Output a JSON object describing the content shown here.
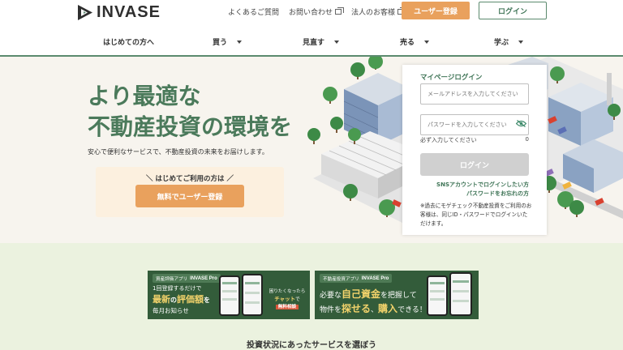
{
  "header": {
    "logo_text": "INVASE",
    "top_links": [
      {
        "label": "よくあるご質問",
        "external": false
      },
      {
        "label": "お問い合わせ",
        "external": true
      },
      {
        "label": "法人のお客様",
        "external": true
      }
    ],
    "register_label": "ユーザー登録",
    "login_label": "ログイン"
  },
  "nav": {
    "items": [
      {
        "label": "はじめての方へ",
        "dropdown": false
      },
      {
        "label": "買う",
        "dropdown": true
      },
      {
        "label": "見直す",
        "dropdown": true
      },
      {
        "label": "売る",
        "dropdown": true
      },
      {
        "label": "学ぶ",
        "dropdown": true
      }
    ]
  },
  "hero": {
    "title_line1": "より最適な",
    "title_line2": "不動産投資の環境を",
    "subtitle": "安心で便利なサービスで、不動産投資の未来をお届けします。",
    "cta_label": "＼ はじめてご利用の方は ／",
    "cta_button": "無料でユーザー登録"
  },
  "login": {
    "title": "マイページログイン",
    "email_placeholder": "メールアドレスを入力してください",
    "password_placeholder": "パスワードを入力してください",
    "required_hint": "必ず入力してください",
    "char_count": "0",
    "button": "ログイン",
    "sns_link": "SNSアカウントでログインしたい方",
    "forgot_link": "パスワードをお忘れの方",
    "notice": "※過去にモゲチェック不動産投資をご利用のお客様は、同じID・パスワードでログインいただけます。"
  },
  "banners": {
    "first": {
      "tag": "資産評価アプリ",
      "tag_brand": "INVASE Pro",
      "line1": "1回登録するだけで",
      "line2_pre": "最新",
      "line2_mid": "の",
      "line2_hl": "評価額",
      "line2_post": "を",
      "line3": "毎月お知らせ",
      "bubble_line1": "困りたくなったら",
      "bubble_chat": "チャット",
      "bubble_line2": "で",
      "bubble_red": "無料相談"
    },
    "second": {
      "tag": "不動産投資アプリ",
      "tag_brand": "INVASE Pro",
      "line1_pre": "必要な",
      "line1_big": "自己資金",
      "line1_post": "を把握して",
      "line2_pre": "物件を",
      "line2_big1": "探せる",
      "line2_mid": "、",
      "line2_big2": "購入",
      "line2_post": "できる！"
    }
  },
  "section_heading": "投資状況にあったサービスを選ぼう",
  "colors": {
    "brand_green": "#4b7a5b",
    "accent_orange": "#e9a15d",
    "hero_bg": "#f7f4ee",
    "lower_bg": "#ebf2df",
    "banner_bg": "#335c3a"
  }
}
